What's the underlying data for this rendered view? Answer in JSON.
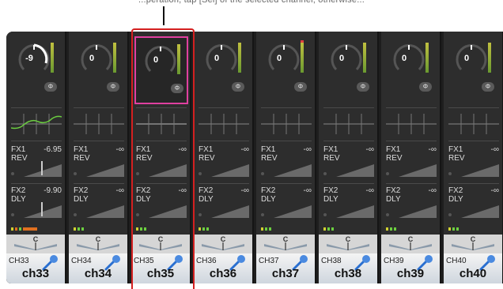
{
  "instruction_text": "...peration, tap [Sel] of the selected channel; otherwise...",
  "colors": {
    "highlight": "#d42020",
    "select_frame": "#e040a0",
    "eq_curve": "#6ccf40"
  },
  "channels": [
    {
      "id": "CH33",
      "name": "ch33",
      "gain": "-9",
      "fx1": {
        "label": "FX1",
        "type": "REV",
        "value": "-6.95"
      },
      "fx2": {
        "label": "FX2",
        "type": "DLY",
        "value": "-9.90"
      },
      "pan": "C",
      "selected": false,
      "eq_active": true
    },
    {
      "id": "CH34",
      "name": "ch34",
      "gain": "0",
      "fx1": {
        "label": "FX1",
        "type": "REV",
        "value": "-∞"
      },
      "fx2": {
        "label": "FX2",
        "type": "DLY",
        "value": "-∞"
      },
      "pan": "C",
      "selected": false,
      "eq_active": false
    },
    {
      "id": "CH35",
      "name": "ch35",
      "gain": "0",
      "fx1": {
        "label": "FX1",
        "type": "REV",
        "value": "-∞"
      },
      "fx2": {
        "label": "FX2",
        "type": "DLY",
        "value": "-∞"
      },
      "pan": "C",
      "selected": true,
      "eq_active": false
    },
    {
      "id": "CH36",
      "name": "ch36",
      "gain": "0",
      "fx1": {
        "label": "FX1",
        "type": "REV",
        "value": "-∞"
      },
      "fx2": {
        "label": "FX2",
        "type": "DLY",
        "value": "-∞"
      },
      "pan": "C",
      "selected": false,
      "eq_active": false
    },
    {
      "id": "CH37",
      "name": "ch37",
      "gain": "0",
      "fx1": {
        "label": "FX1",
        "type": "REV",
        "value": "-∞"
      },
      "fx2": {
        "label": "FX2",
        "type": "DLY",
        "value": "-∞"
      },
      "pan": "C",
      "selected": false,
      "eq_active": false
    },
    {
      "id": "CH38",
      "name": "ch38",
      "gain": "0",
      "fx1": {
        "label": "FX1",
        "type": "REV",
        "value": "-∞"
      },
      "fx2": {
        "label": "FX2",
        "type": "DLY",
        "value": "-∞"
      },
      "pan": "C",
      "selected": false,
      "eq_active": false
    },
    {
      "id": "CH39",
      "name": "ch39",
      "gain": "0",
      "fx1": {
        "label": "FX1",
        "type": "REV",
        "value": "-∞"
      },
      "fx2": {
        "label": "FX2",
        "type": "DLY",
        "value": "-∞"
      },
      "pan": "C",
      "selected": false,
      "eq_active": false
    },
    {
      "id": "CH40",
      "name": "ch40",
      "gain": "0",
      "fx1": {
        "label": "FX1",
        "type": "REV",
        "value": "-∞"
      },
      "fx2": {
        "label": "FX2",
        "type": "DLY",
        "value": "-∞"
      },
      "pan": "C",
      "selected": false,
      "eq_active": false
    }
  ],
  "phase_symbol": "Φ",
  "icons": {
    "phase": "phase-icon",
    "mic": "microphone-icon"
  }
}
